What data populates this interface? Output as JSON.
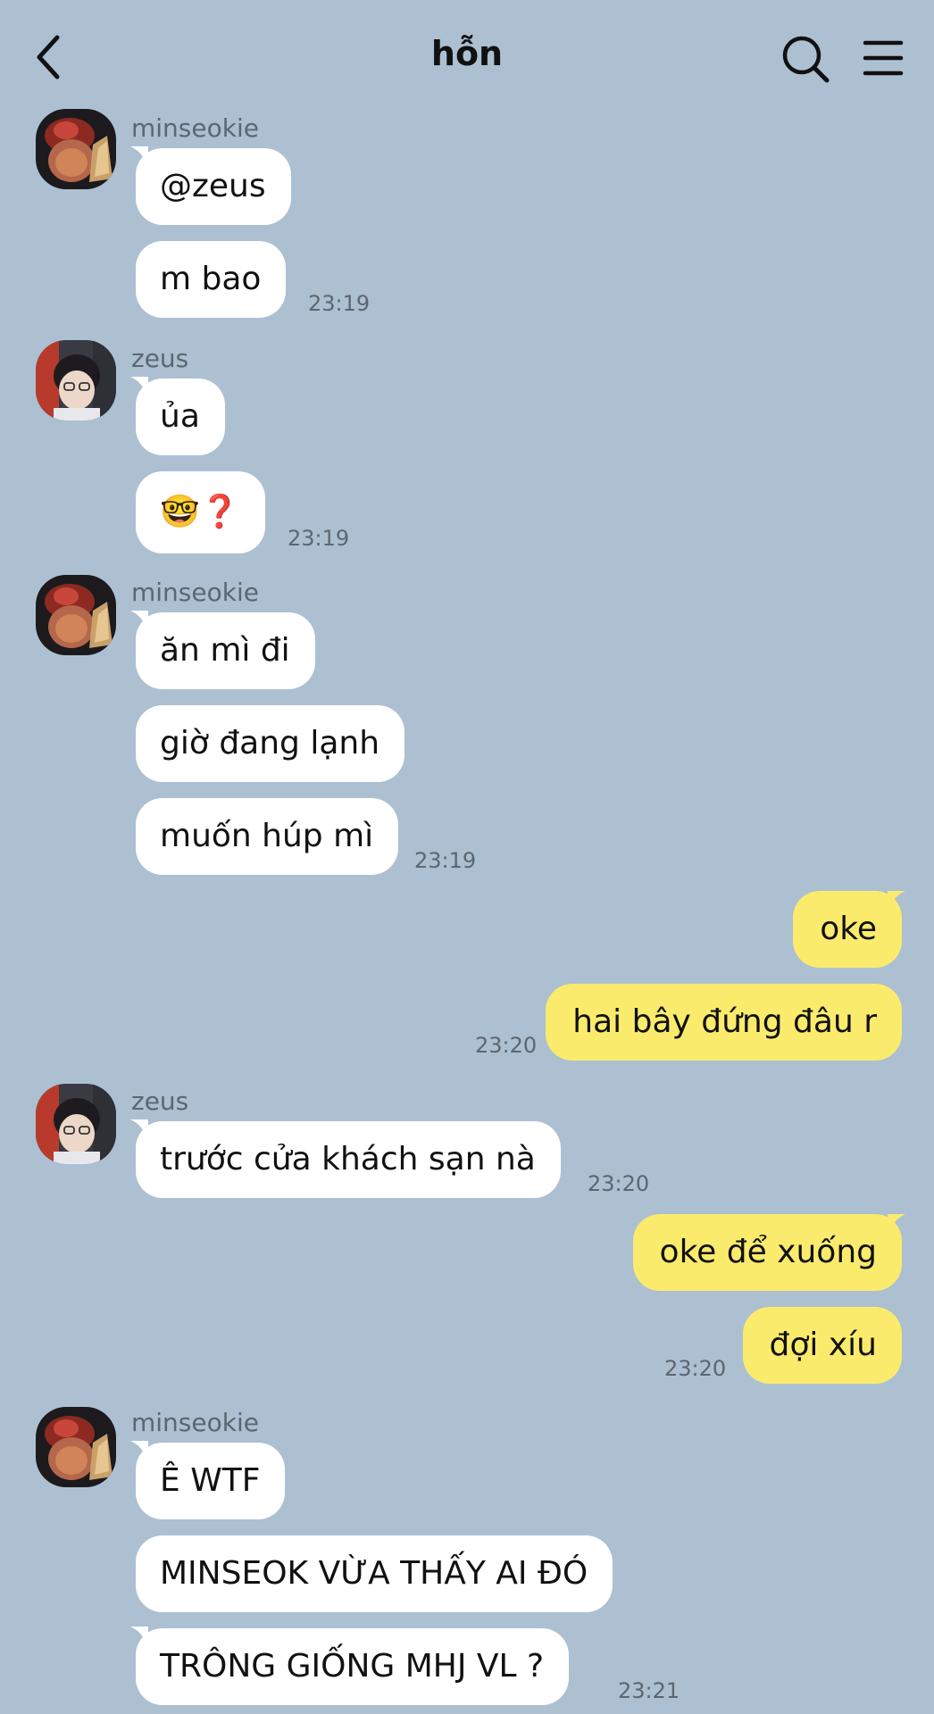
{
  "header": {
    "title": "hỗn"
  },
  "theme": {
    "background": "#acc0d2",
    "incoming_bubble": "#ffffff",
    "outgoing_bubble": "#fbeb6c"
  },
  "icons": {
    "back": "chevron-left-icon",
    "search": "search-icon",
    "menu": "hamburger-menu-icon"
  },
  "messages": [
    {
      "sender": "minseokie",
      "direction": "in",
      "texts": [
        "@zeus",
        "m bao"
      ],
      "time": "23:19"
    },
    {
      "sender": "zeus",
      "direction": "in",
      "texts": [
        "ủa",
        "🤓❓"
      ],
      "time": "23:19"
    },
    {
      "sender": "minseokie",
      "direction": "in",
      "texts": [
        "ăn mì đi",
        "giờ đang lạnh",
        "muốn húp mì"
      ],
      "time": "23:19"
    },
    {
      "sender": "",
      "direction": "out",
      "texts": [
        "oke",
        "hai bây đứng đâu r"
      ],
      "time": "23:20"
    },
    {
      "sender": "zeus",
      "direction": "in",
      "texts": [
        "trước cửa khách sạn nà"
      ],
      "time": "23:20"
    },
    {
      "sender": "",
      "direction": "out",
      "texts": [
        "oke để xuống",
        "đợi xíu"
      ],
      "time": "23:20"
    },
    {
      "sender": "minseokie",
      "direction": "in",
      "texts": [
        "Ê WTF",
        "MINSEOK VỪA THẤY AI ĐÓ",
        "TRÔNG GIỐNG MHJ VL ?"
      ],
      "time": "23:21"
    }
  ]
}
